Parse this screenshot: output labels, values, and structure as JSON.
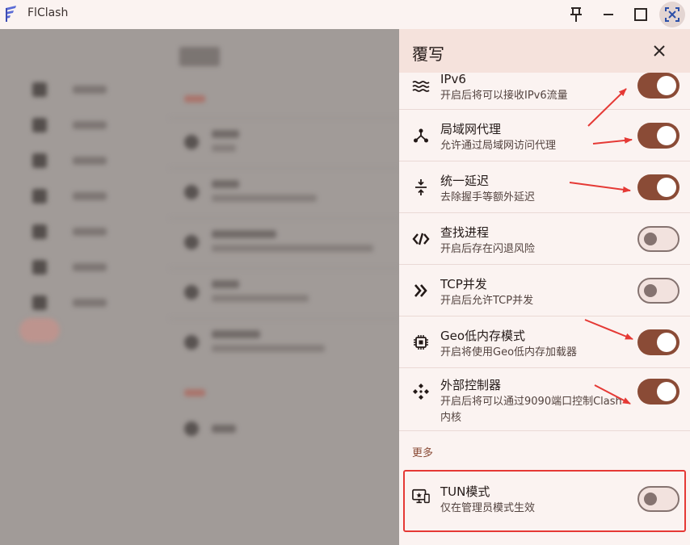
{
  "window": {
    "title": "FlClash",
    "controls": [
      "pin-icon",
      "minimize-icon",
      "maximize-icon",
      "fullscreen-icon"
    ]
  },
  "panel": {
    "title": "覆写",
    "items": [
      {
        "title": "IPv6",
        "subtitle": "开启后将可以接收IPv6流量",
        "icon": "waves-icon",
        "enabled": true
      },
      {
        "title": "局域网代理",
        "subtitle": "允许通过局域网访问代理",
        "icon": "lan-hub-icon",
        "enabled": true
      },
      {
        "title": "统一延迟",
        "subtitle": "去除握手等额外延迟",
        "icon": "compress-icon",
        "enabled": true
      },
      {
        "title": "查找进程",
        "subtitle": "开启后存在闪退风险",
        "icon": "code-slash-icon",
        "enabled": false
      },
      {
        "title": "TCP并发",
        "subtitle": "开启后允许TCP并发",
        "icon": "double-chevron-icon",
        "enabled": false
      },
      {
        "title": "Geo低内存模式",
        "subtitle": "开启将使用Geo低内存加载器",
        "icon": "chip-icon",
        "enabled": true
      },
      {
        "title": "外部控制器",
        "subtitle": "开启后将可以通过9090端口控制Clash内核",
        "icon": "controller-icon",
        "enabled": true
      }
    ],
    "more_label": "更多",
    "tun": {
      "title": "TUN模式",
      "subtitle": "仅在管理员模式生效",
      "icon": "monitor-icon",
      "enabled": false
    }
  },
  "colors": {
    "accent": "#8a4b36",
    "header": "#f5e2dc",
    "background": "#fbf3f1",
    "annotation": "#e53935"
  }
}
